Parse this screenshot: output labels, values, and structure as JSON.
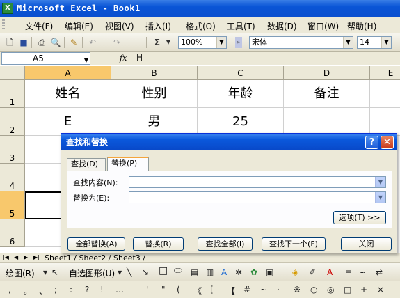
{
  "window": {
    "title": "Microsoft Excel - Book1",
    "app_icon": "excel-icon"
  },
  "menu": [
    "文件(F)",
    "编辑(E)",
    "视图(V)",
    "插入(I)",
    "格式(O)",
    "工具(T)",
    "数据(D)",
    "窗口(W)",
    "帮助(H)"
  ],
  "toolbar": {
    "zoom": "100%",
    "font_name": "宋体",
    "font_size": "14",
    "sigma": "Σ"
  },
  "formula_bar": {
    "name_box": "A5",
    "fx": "fx",
    "content": "H"
  },
  "columns": [
    "A",
    "B",
    "C",
    "D",
    "E"
  ],
  "rows": [
    "1",
    "2",
    "3",
    "4",
    "5",
    "6"
  ],
  "cells": {
    "A1": "姓名",
    "B1": "性别",
    "C1": "年龄",
    "D1": "备注",
    "A2": "E",
    "B2": "男",
    "C2": "25"
  },
  "sheet_tabs": "Sheet1 / Sheet2 / Sheet3 /",
  "drawing_toolbar": {
    "draw": "绘图(R)",
    "autoshapes": "自选图形(U)"
  },
  "symbols": [
    ",",
    "。",
    "、",
    ";",
    ":",
    "?",
    "!",
    "…",
    "—",
    "'",
    "\"",
    "(",
    "《",
    "[",
    "【",
    "#",
    "~",
    "·",
    "※",
    "○",
    "◎",
    "□",
    "+",
    "×"
  ],
  "dialog": {
    "title": "查找和替换",
    "tabs": [
      "查找(D)",
      "替换(P)"
    ],
    "active_tab": "替换(P)",
    "find_label": "查找内容(N):",
    "find_value": "",
    "replace_label": "替换为(E):",
    "replace_value": "",
    "options_button": "选项(T) >>",
    "buttons": [
      "全部替换(A)",
      "替换(R)",
      "查找全部(I)",
      "查找下一个(F)",
      "关闭"
    ]
  }
}
